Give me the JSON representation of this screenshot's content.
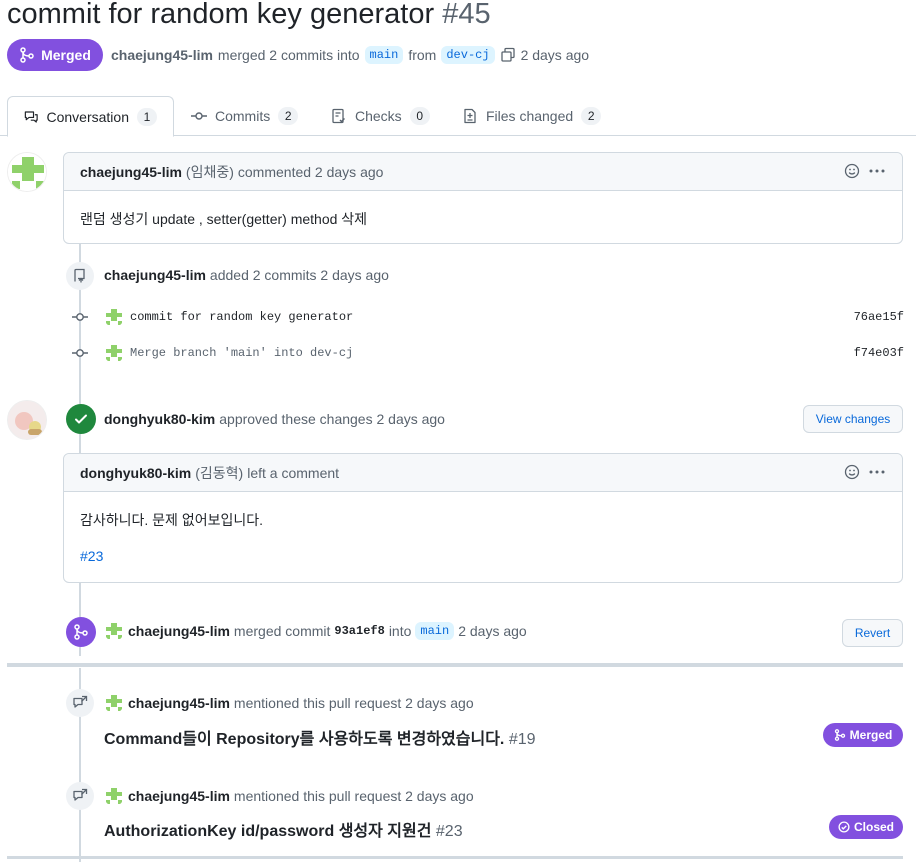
{
  "pr": {
    "title": "commit for random key generator",
    "number": "#45",
    "state_label": "Merged",
    "author": "chaejung45-lim",
    "merged_text": "merged 2 commits into",
    "base_branch": "main",
    "from_text": "from",
    "head_branch": "dev-cj",
    "time": "2 days ago"
  },
  "tabs": [
    {
      "label": "Conversation",
      "count": "1"
    },
    {
      "label": "Commits",
      "count": "2"
    },
    {
      "label": "Checks",
      "count": "0"
    },
    {
      "label": "Files changed",
      "count": "2"
    }
  ],
  "comment1": {
    "author": "chaejung45-lim",
    "display_name": "(임채중)",
    "action": "commented 2 days ago",
    "body": "랜덤 생성기 update , setter(getter) method 삭제"
  },
  "commits_event": {
    "author": "chaejung45-lim",
    "text": "added 2 commits 2 days ago",
    "commits": [
      {
        "message": "commit for random key generator",
        "sha": "76ae15f"
      },
      {
        "message": "Merge branch 'main' into dev-cj",
        "sha": "f74e03f"
      }
    ]
  },
  "review": {
    "author": "donghyuk80-kim",
    "text": "approved these changes 2 days ago",
    "button": "View changes"
  },
  "comment2": {
    "author": "donghyuk80-kim",
    "display_name": "(김동혁)",
    "action": "left a comment",
    "body": "감사하니다. 문제 없어보입니다.",
    "ref": "#23"
  },
  "merge_event": {
    "author": "chaejung45-lim",
    "text1": "merged commit",
    "sha": "93a1ef8",
    "text2": "into",
    "branch": "main",
    "time": "2 days ago",
    "button": "Revert"
  },
  "mentions": [
    {
      "author": "chaejung45-lim",
      "text": "mentioned this pull request 2 days ago",
      "title": "Command들이 Repository를 사용하도록 변경하였습니다.",
      "number": "#19",
      "state": "Merged"
    },
    {
      "author": "chaejung45-lim",
      "text": "mentioned this pull request 2 days ago",
      "title": "AuthorizationKey id/password 생성자 지원건",
      "number": "#23",
      "state": "Closed"
    }
  ],
  "colors": {
    "merged": "#8250df",
    "approved": "#1f883d",
    "link": "#0969da"
  }
}
